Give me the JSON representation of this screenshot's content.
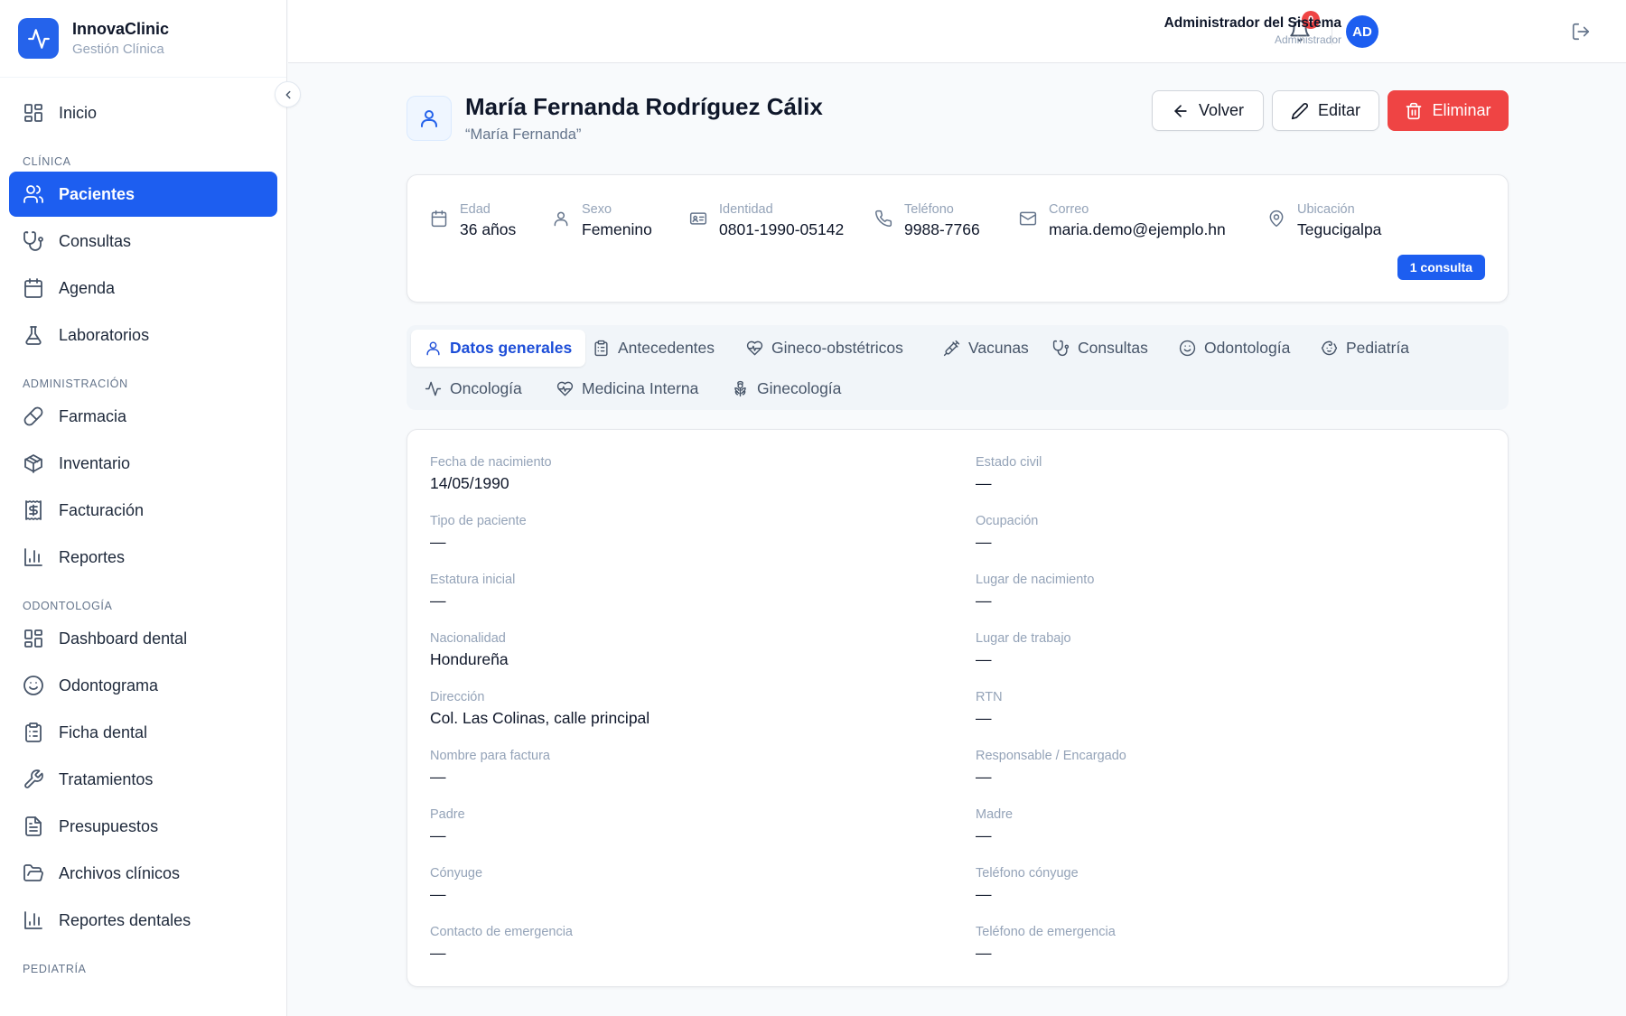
{
  "brand": {
    "name": "InnovaClinic",
    "subtitle": "Gestión Clínica",
    "logo_icon": "activity-icon",
    "accent": "#1d5ef0"
  },
  "sidebar": {
    "top_items": [
      {
        "label": "Inicio",
        "icon": "dashboard-icon"
      }
    ],
    "sections": [
      {
        "title": "CLÍNICA",
        "items": [
          {
            "label": "Pacientes",
            "icon": "users-icon",
            "active": true
          },
          {
            "label": "Consultas",
            "icon": "stethoscope-icon"
          },
          {
            "label": "Agenda",
            "icon": "calendar-icon"
          },
          {
            "label": "Laboratorios",
            "icon": "flask-icon"
          }
        ]
      },
      {
        "title": "ADMINISTRACIÓN",
        "items": [
          {
            "label": "Farmacia",
            "icon": "pill-icon"
          },
          {
            "label": "Inventario",
            "icon": "package-icon"
          },
          {
            "label": "Facturación",
            "icon": "receipt-icon"
          },
          {
            "label": "Reportes",
            "icon": "bar-chart-icon"
          }
        ]
      },
      {
        "title": "ODONTOLOGÍA",
        "items": [
          {
            "label": "Dashboard dental",
            "icon": "dashboard-icon"
          },
          {
            "label": "Odontograma",
            "icon": "smile-icon"
          },
          {
            "label": "Ficha dental",
            "icon": "clipboard-icon"
          },
          {
            "label": "Tratamientos",
            "icon": "wrench-icon"
          },
          {
            "label": "Presupuestos",
            "icon": "file-text-icon"
          },
          {
            "label": "Archivos clínicos",
            "icon": "folder-open-icon"
          },
          {
            "label": "Reportes dentales",
            "icon": "bar-chart-icon"
          }
        ]
      },
      {
        "title": "PEDIATRÍA",
        "items": []
      }
    ]
  },
  "topbar": {
    "notification_count": "0",
    "avatar_initials": "AD",
    "user_name": "Administrador del Sistema",
    "user_role": "Administrador"
  },
  "patient": {
    "name": "María Fernanda Rodríguez Cálix",
    "alias": "“María Fernanda”"
  },
  "actions": {
    "back": "Volver",
    "edit": "Editar",
    "delete": "Eliminar",
    "danger_color": "#ef4444"
  },
  "summary": [
    {
      "label": "Edad",
      "value": "36 años",
      "icon": "calendar-icon"
    },
    {
      "label": "Sexo",
      "value": "Femenino",
      "icon": "user-icon"
    },
    {
      "label": "Identidad",
      "value": "0801-1990-05142",
      "icon": "id-card-icon"
    },
    {
      "label": "Teléfono",
      "value": "9988-7766",
      "icon": "phone-icon"
    },
    {
      "label": "Correo",
      "value": "maria.demo@ejemplo.hn",
      "icon": "mail-icon"
    },
    {
      "label": "Ubicación",
      "value": "Tegucigalpa",
      "icon": "map-pin-icon"
    }
  ],
  "consult_badge": "1 consulta",
  "tabs": [
    {
      "label": "Datos generales",
      "icon": "user-icon",
      "active": true
    },
    {
      "label": "Antecedentes",
      "icon": "clipboard-icon"
    },
    {
      "label": "Gineco-obstétricos",
      "icon": "heart-pulse-icon"
    },
    {
      "label": "Vacunas",
      "icon": "syringe-icon"
    },
    {
      "label": "Consultas",
      "icon": "stethoscope-icon"
    },
    {
      "label": "Odontología",
      "icon": "smile-icon"
    },
    {
      "label": "Pediatría",
      "icon": "baby-icon"
    },
    {
      "label": "Oncología",
      "icon": "activity-icon"
    },
    {
      "label": "Medicina Interna",
      "icon": "heart-pulse-icon"
    },
    {
      "label": "Ginecología",
      "icon": "flower-icon"
    }
  ],
  "fields": [
    {
      "label": "Fecha de nacimiento",
      "value": "14/05/1990"
    },
    {
      "label": "Estado civil",
      "value": "—"
    },
    {
      "label": "Tipo de paciente",
      "value": "—"
    },
    {
      "label": "Ocupación",
      "value": "—"
    },
    {
      "label": "Estatura inicial",
      "value": "—"
    },
    {
      "label": "Lugar de nacimiento",
      "value": "—"
    },
    {
      "label": "Nacionalidad",
      "value": "Hondureña"
    },
    {
      "label": "Lugar de trabajo",
      "value": "—"
    },
    {
      "label": "Dirección",
      "value": "Col. Las Colinas, calle principal"
    },
    {
      "label": "RTN",
      "value": "—"
    },
    {
      "label": "Nombre para factura",
      "value": "—"
    },
    {
      "label": "Responsable / Encargado",
      "value": "—"
    },
    {
      "label": "Padre",
      "value": "—"
    },
    {
      "label": "Madre",
      "value": "—"
    },
    {
      "label": "Cónyuge",
      "value": "—"
    },
    {
      "label": "Teléfono cónyuge",
      "value": "—"
    },
    {
      "label": "Contacto de emergencia",
      "value": "—"
    },
    {
      "label": "Teléfono de emergencia",
      "value": "—"
    }
  ]
}
